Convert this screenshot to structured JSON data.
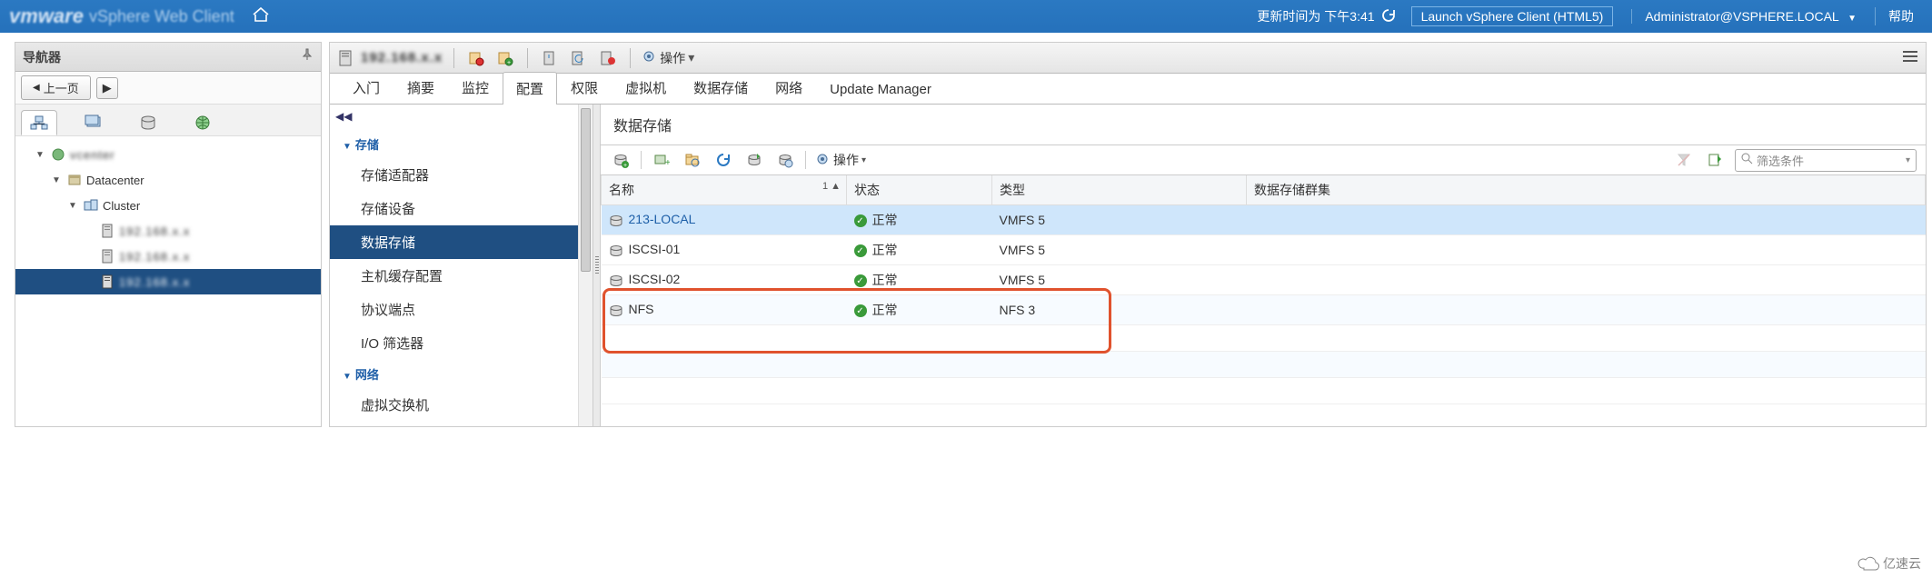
{
  "topbar": {
    "brand": "vmware",
    "product": "vSphere Web Client",
    "update_label": "更新时间为 下午3:41",
    "launch_label": "Launch vSphere Client (HTML5)",
    "user_label": "Administrator@VSPHERE.LOCAL",
    "help_label": "帮助"
  },
  "navigator": {
    "title": "导航器",
    "back_label": "上一页",
    "tree": {
      "root_label": "vcenter",
      "datacenter_label": "Datacenter",
      "cluster_label": "Cluster",
      "host1_label": "192.168.x.x",
      "host2_label": "192.168.x.x",
      "host3_label": "192.168.x.x"
    }
  },
  "object_toolbar": {
    "hostname": "192.168.x.x",
    "actions_label": "操作"
  },
  "main_tabs": {
    "items": [
      {
        "label": "入门"
      },
      {
        "label": "摘要"
      },
      {
        "label": "监控"
      },
      {
        "label": "配置"
      },
      {
        "label": "权限"
      },
      {
        "label": "虚拟机"
      },
      {
        "label": "数据存储"
      },
      {
        "label": "网络"
      },
      {
        "label": "Update Manager"
      }
    ],
    "active_index": 3
  },
  "config_nav": {
    "groups": [
      {
        "label": "存储",
        "items": [
          {
            "label": "存储适配器"
          },
          {
            "label": "存储设备"
          },
          {
            "label": "数据存储",
            "active": true
          },
          {
            "label": "主机缓存配置"
          },
          {
            "label": "协议端点"
          },
          {
            "label": "I/O 筛选器"
          }
        ]
      },
      {
        "label": "网络",
        "items": [
          {
            "label": "虚拟交换机"
          }
        ]
      }
    ]
  },
  "datastores": {
    "title": "数据存储",
    "toolbar_actions_label": "操作",
    "filter_placeholder": "筛选条件",
    "columns": {
      "name": "名称",
      "sort_indicator": "1 ▲",
      "status": "状态",
      "type": "类型",
      "cluster": "数据存储群集"
    },
    "rows": [
      {
        "name": "213-LOCAL",
        "status": "正常",
        "type": "VMFS 5",
        "selected": true,
        "link": true
      },
      {
        "name": "ISCSI-01",
        "status": "正常",
        "type": "VMFS 5"
      },
      {
        "name": "ISCSI-02",
        "status": "正常",
        "type": "VMFS 5"
      },
      {
        "name": "NFS",
        "status": "正常",
        "type": "NFS 3",
        "alt": true
      }
    ]
  },
  "watermark": {
    "text": "亿速云"
  }
}
